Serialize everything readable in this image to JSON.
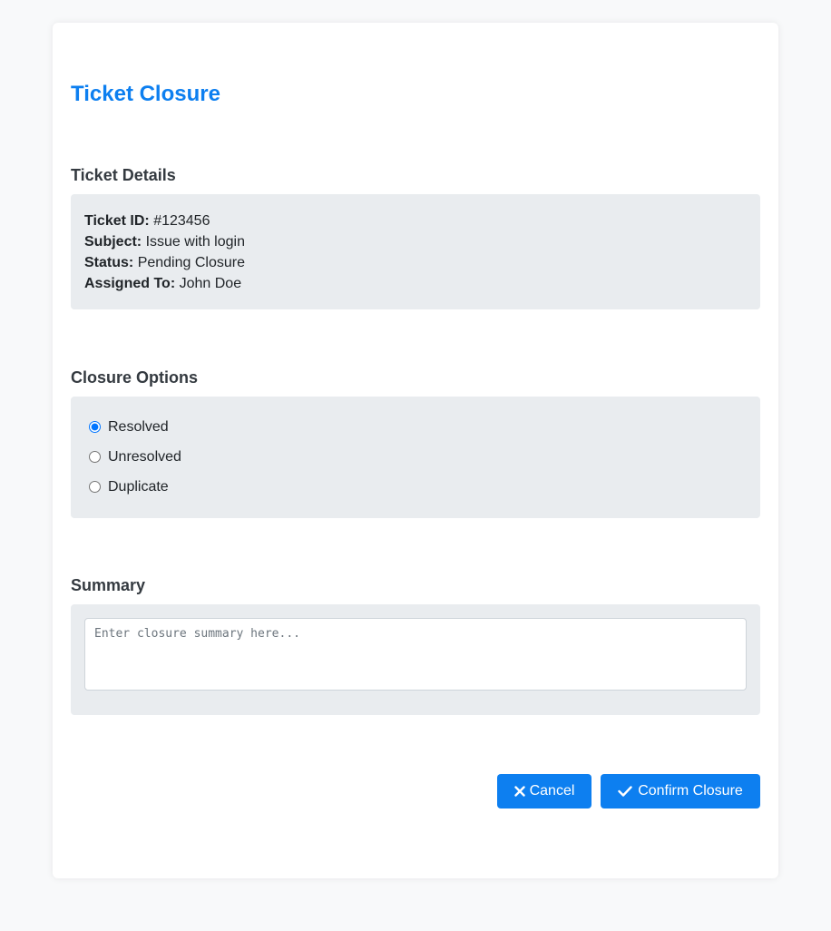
{
  "page": {
    "title": "Ticket Closure"
  },
  "details": {
    "heading": "Ticket Details",
    "rows": [
      {
        "label": "Ticket ID:",
        "value": "#123456"
      },
      {
        "label": "Subject:",
        "value": "Issue with login"
      },
      {
        "label": "Status:",
        "value": "Pending Closure"
      },
      {
        "label": "Assigned To:",
        "value": "John Doe"
      }
    ]
  },
  "closure": {
    "heading": "Closure Options",
    "options": [
      {
        "label": "Resolved",
        "checked": true
      },
      {
        "label": "Unresolved",
        "checked": false
      },
      {
        "label": "Duplicate",
        "checked": false
      }
    ]
  },
  "summary": {
    "heading": "Summary",
    "placeholder": "Enter closure summary here...",
    "value": ""
  },
  "actions": {
    "cancel_label": "Cancel",
    "cancel_icon": "close-icon",
    "confirm_label": "Confirm Closure",
    "confirm_icon": "check-icon"
  },
  "colors": {
    "accent": "#0d7ff0",
    "panel_bg": "#e9ecef",
    "page_bg": "#f8f9fa"
  }
}
